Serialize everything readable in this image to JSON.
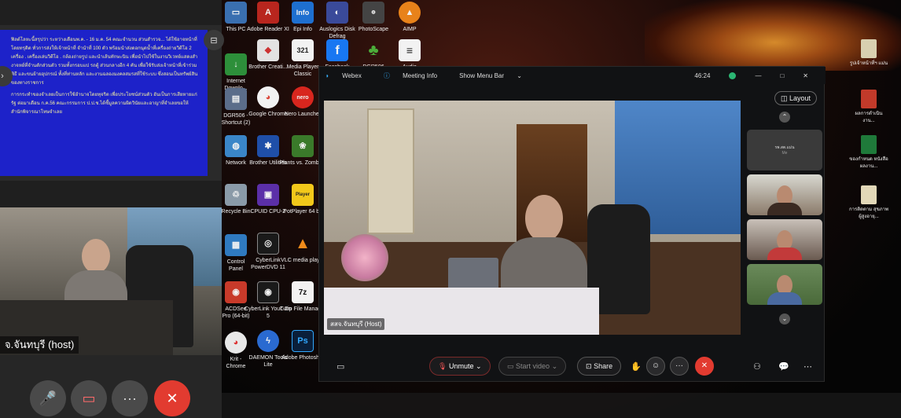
{
  "desktop": {
    "icons_partial_col": [
      {
        "label": "This PC",
        "icon": "computer-icon"
      },
      {
        "label": "Internet Downlo...",
        "icon": "download-icon"
      },
      {
        "label": "DGR506 - Shortcut (2)",
        "icon": "shortcut-icon"
      },
      {
        "label": "Network",
        "icon": "network-icon"
      },
      {
        "label": "Recycle Bin",
        "icon": "recycle-bin-icon"
      },
      {
        "label": "Control Panel",
        "icon": "control-panel-icon"
      },
      {
        "label": "ACDSee Pro (64-bit)",
        "icon": "acdsee-icon"
      },
      {
        "label": "Krit - Chrome",
        "icon": "chrome-icon"
      }
    ],
    "icons_col1": [
      {
        "label": "Adobe Reader XI",
        "icon": "adobe-reader-icon"
      },
      {
        "label": "Brother Creati...",
        "icon": "brother-icon"
      },
      {
        "label": "Google Chrome",
        "icon": "chrome-icon"
      },
      {
        "label": "Brother Utilities",
        "icon": "brother-utilities-icon"
      },
      {
        "label": "CPUID CPU-Z",
        "icon": "cpuz-icon"
      },
      {
        "label": "CyberLink PowerDVD 11",
        "icon": "powerdvd-icon"
      },
      {
        "label": "CyberLink YouCam 5",
        "icon": "youcam-icon"
      },
      {
        "label": "DAEMON Tools Lite",
        "icon": "daemon-tools-icon"
      }
    ],
    "icons_col2": [
      {
        "label": "Epi Info",
        "icon": "epi-info-icon",
        "glyph": "Info"
      },
      {
        "label": "Media Player Classic",
        "icon": "media-player-icon",
        "glyph": "321"
      },
      {
        "label": "Nero Launcher",
        "icon": "nero-icon",
        "glyph": "nero"
      },
      {
        "label": "Plants vs. Zombies",
        "icon": "plants-icon",
        "glyph": "❀"
      },
      {
        "label": "PotPlayer 64 bit",
        "icon": "potplayer-icon",
        "glyph": "Player"
      },
      {
        "label": "VLC media player",
        "icon": "vlc-icon",
        "glyph": "▲"
      },
      {
        "label": "7-Zip File Manager",
        "icon": "7zip-icon",
        "glyph": "7z"
      },
      {
        "label": "Adobe Photosh...",
        "icon": "photoshop-icon",
        "glyph": "Ps"
      }
    ],
    "icons_top": [
      {
        "label": "Auslogics Disk Defrag",
        "icon": "defrag-icon"
      },
      {
        "label": "PhotoScape",
        "icon": "photoscape-icon"
      },
      {
        "label": "AIMP",
        "icon": "aimp-icon"
      }
    ],
    "icons_row2": [
      {
        "label": "Facebook",
        "icon": "facebook-icon",
        "glyph": "f"
      },
      {
        "label": "DGR506",
        "icon": "tree-icon",
        "glyph": "♣"
      },
      {
        "label": "Audio",
        "icon": "audio-icon",
        "glyph": "≡"
      }
    ],
    "icons_right": [
      {
        "label": "รูปเจ้าหน้าที่ฯ แม่น"
      },
      {
        "label": "ผลการดำเนินงาน..."
      },
      {
        "label": "ของกำหนด หนังสือผลงาน..."
      },
      {
        "label": "การติดตาม สุขภาพผู้สูงอายุ..."
      }
    ]
  },
  "left_panel": {
    "slide_paragraphs": [
      "ฟิลด์โลหะนี้สรุปว่า ระหว่างเดือนพ.ค. - 16 ม.ค. 54 คณะจำนวน ส่วนสำรวจ... ได้ใช้อาจหน้าที่โดยทรุดิต ทั่วการส่งให้เจ้าหน้าที่ จำนำที่ 100 ตัว พร้อมนำส่งดอกนุดน้ำที่เครื่องถ่ายวิดีโอ 2 เครื่อง . เครื่องเล่นวิดีโอ . กล้องถ่ายรูป และนำเส้นทักษะนิน เพื่อนำไปใช้ในงานวิเวทย์แสดงสำงาจหย์ที่จำนดักส่วนตัว รวมทั้งกรอบแป รถตู้ ส่วนกลางอีก 4 คัน เพื่อใช้รับส่งเจ้าหน้าที่เข้าร่วมพิธี และขนย้ายอุปกรณ์ ทั้งที่ท่านหลัก และงานฉลองมงคลสมรสที่ใช้ระบบ ซึ่งสอนเป็นทรัพย์สินของทางราชการ",
      "การกระทำของจำเลยเป็นการใช้อำนาจโดยทุจริต เพื่อประโยชน์ส่วนตัว อันเป็นการเสียหายแก่รัฐ ต่อมาเดือน ก.ค.56 คณะกรรมการ ป.ป.ช.ได้ชี้มูลความผิดวินัยและอาญาที่จำเลยขอให้สำนักพิจารณาโทษจำเลย"
    ],
    "name_label": "จ.จันทบุรี (host)",
    "buttons": {
      "mic": "🎤",
      "video": "▭",
      "more": "···",
      "leave": "✕"
    }
  },
  "webex": {
    "title_bar": {
      "app": "Webex",
      "meeting_info": "Meeting Info",
      "menu_bar": "Show Menu Bar",
      "timer": "46:24"
    },
    "layout_label": "Layout",
    "main_video_label": "สสจ.จันทบุรี (Host)",
    "thumbnails": [
      {
        "name": "รพ.สต.แม่น",
        "sub": "Me"
      }
    ],
    "toolbar": {
      "unmute": "Unmute",
      "start_video": "Start video",
      "share": "Share"
    }
  },
  "colors": {
    "accent_red": "#e23b30",
    "slide_blue": "#1d22c9",
    "slide_text": "#f5f0a0",
    "green_status": "#2bb673"
  }
}
